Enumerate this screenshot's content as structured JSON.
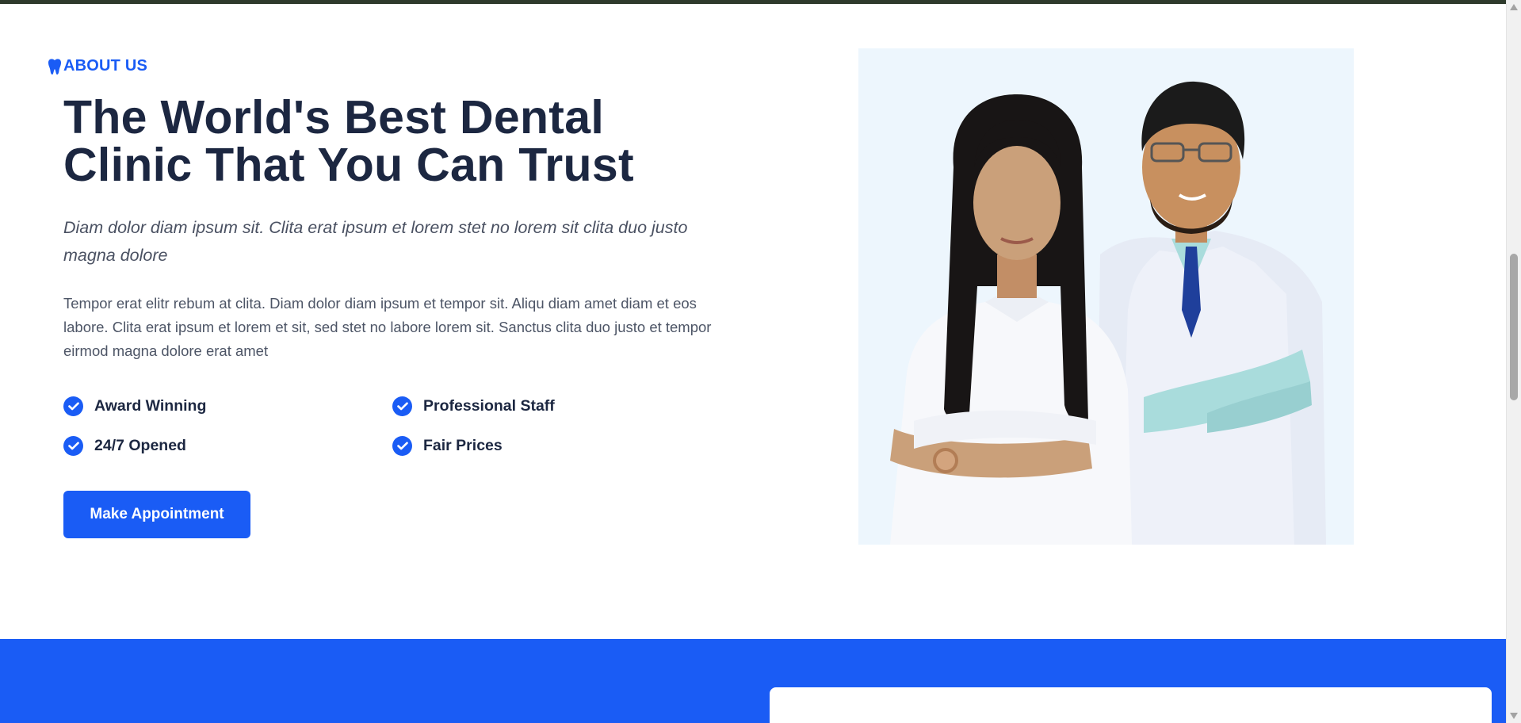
{
  "about": {
    "icon": "tooth-icon",
    "label": "ABOUT US"
  },
  "headline": "The World's Best Dental Clinic That You Can Trust",
  "lead": "Diam dolor diam ipsum sit. Clita erat ipsum et lorem stet no lorem sit clita duo justo magna dolore",
  "body": "Tempor erat elitr rebum at clita. Diam dolor diam ipsum et tempor sit. Aliqu diam amet diam et eos labore. Clita erat ipsum et lorem et sit, sed stet no labore lorem sit. Sanctus clita duo justo et tempor eirmod magna dolore erat amet",
  "features": [
    {
      "label": "Award Winning",
      "icon": "check-circle-icon"
    },
    {
      "label": "Professional Staff",
      "icon": "check-circle-icon"
    },
    {
      "label": "24/7 Opened",
      "icon": "check-circle-icon"
    },
    {
      "label": "Fair Prices",
      "icon": "check-circle-icon"
    }
  ],
  "cta": {
    "label": "Make Appointment"
  },
  "colors": {
    "accent": "#1a5cf5",
    "heading": "#1c2741",
    "text": "#4d5566",
    "photo_bg": "#edf6fd"
  }
}
